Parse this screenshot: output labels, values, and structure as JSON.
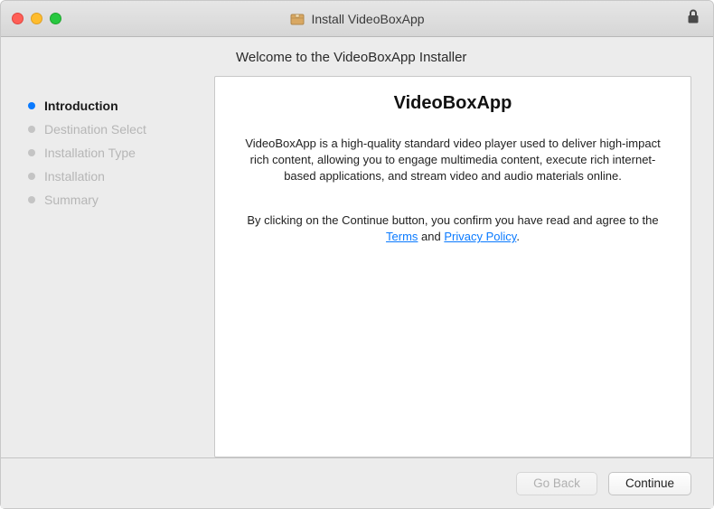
{
  "window": {
    "title": "Install VideoBoxApp"
  },
  "header": {
    "welcome": "Welcome to the VideoBoxApp Installer"
  },
  "sidebar": {
    "steps": [
      {
        "label": "Introduction",
        "active": true
      },
      {
        "label": "Destination Select",
        "active": false
      },
      {
        "label": "Installation Type",
        "active": false
      },
      {
        "label": "Installation",
        "active": false
      },
      {
        "label": "Summary",
        "active": false
      }
    ]
  },
  "content": {
    "title": "VideoBoxApp",
    "description": "VideoBoxApp is a high-quality standard video player used to deliver high-impact rich content, allowing you to engage multimedia content, execute rich internet-based applications, and stream video and audio materials online.",
    "agree_pre": "By clicking on the Continue button, you confirm you have read and agree to the ",
    "terms": "Terms",
    "and": " and ",
    "privacy": "Privacy Policy",
    "period": "."
  },
  "footer": {
    "back": "Go Back",
    "continue": "Continue"
  }
}
